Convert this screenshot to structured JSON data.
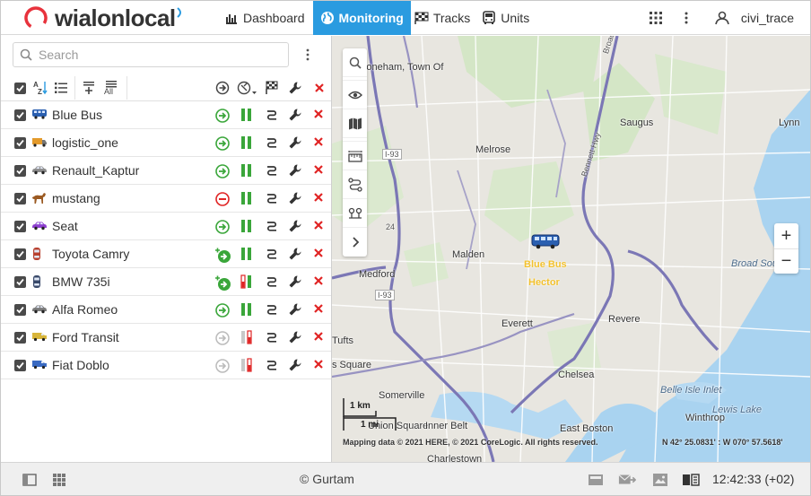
{
  "app": {
    "logo_text": "wialonlocal",
    "user_name": "civi_trace"
  },
  "nav": [
    {
      "label": "Dashboard",
      "icon": "bar-chart-icon"
    },
    {
      "label": "Monitoring",
      "icon": "globe-icon"
    },
    {
      "label": "Tracks",
      "icon": "checkered-flag-icon"
    },
    {
      "label": "Units",
      "icon": "bus-icon"
    }
  ],
  "search": {
    "placeholder": "Search",
    "value": ""
  },
  "toolbar": {
    "sort_label": "AZ",
    "add_all_label": "All"
  },
  "units": [
    {
      "name": "Blue Bus",
      "icon": "bus-icon",
      "color": "#2a5fb0",
      "state": "moving",
      "sensor": "green"
    },
    {
      "name": "logistic_one",
      "icon": "truck-icon",
      "color": "#e39a2b",
      "state": "moving",
      "sensor": "green"
    },
    {
      "name": "Renault_Kaptur",
      "icon": "car-icon",
      "color": "#8a8a8a",
      "state": "moving",
      "sensor": "green"
    },
    {
      "name": "mustang",
      "icon": "horse-icon",
      "color": "#9b5a22",
      "state": "stopped",
      "sensor": "green"
    },
    {
      "name": "Seat",
      "icon": "car-icon",
      "color": "#8e3fd0",
      "state": "moving",
      "sensor": "green"
    },
    {
      "name": "Toyota Camry",
      "icon": "car-top-icon",
      "color": "#b8412f",
      "state": "moving-plus",
      "sensor": "green"
    },
    {
      "name": "BMW 735i",
      "icon": "car-top-icon",
      "color": "#3a4a6a",
      "state": "moving-plus",
      "sensor": "red-green"
    },
    {
      "name": "Alfa Romeo",
      "icon": "car-icon",
      "color": "#7a7a7a",
      "state": "moving",
      "sensor": "green"
    },
    {
      "name": "Ford Transit",
      "icon": "van-icon",
      "color": "#d8b53a",
      "state": "offline",
      "sensor": "gray-red"
    },
    {
      "name": "Fiat Doblo",
      "icon": "van-icon",
      "color": "#3a6ac2",
      "state": "offline",
      "sensor": "gray-red"
    }
  ],
  "map": {
    "labels": [
      {
        "text": "Stoneham, Town Of",
        "kind": "place"
      },
      {
        "text": "Melrose",
        "kind": "place"
      },
      {
        "text": "Saugus",
        "kind": "place"
      },
      {
        "text": "Lynn",
        "kind": "place"
      },
      {
        "text": "Malden",
        "kind": "place"
      },
      {
        "text": "Medford",
        "kind": "place"
      },
      {
        "text": "Everett",
        "kind": "place"
      },
      {
        "text": "Revere",
        "kind": "place"
      },
      {
        "text": "Tufts",
        "kind": "place"
      },
      {
        "text": "Somerville",
        "kind": "place"
      },
      {
        "text": "s Square",
        "kind": "place"
      },
      {
        "text": "Union Square",
        "kind": "place"
      },
      {
        "text": "Inner Belt",
        "kind": "place"
      },
      {
        "text": "Chelsea",
        "kind": "place"
      },
      {
        "text": "East Boston",
        "kind": "place"
      },
      {
        "text": "Winthrop",
        "kind": "place"
      },
      {
        "text": "Charlestown",
        "kind": "place"
      },
      {
        "text": "Broad Sou",
        "kind": "water"
      },
      {
        "text": "Belle Isle Inlet",
        "kind": "water"
      },
      {
        "text": "Lewis Lake",
        "kind": "water"
      },
      {
        "text": "I-93",
        "kind": "road"
      },
      {
        "text": "I-93",
        "kind": "road"
      },
      {
        "text": "Broadway",
        "kind": "road"
      },
      {
        "text": "Bennett Hwy",
        "kind": "road"
      },
      {
        "text": "24",
        "kind": "road"
      }
    ],
    "unit_marker_labels": [
      "Blue Bus",
      "Hector"
    ],
    "scale_labels": [
      "1 km",
      "1 mi"
    ],
    "attribution": "Mapping data © 2021 HERE, © 2021 CoreLogic. All rights reserved.",
    "coordinates": "N 42° 25.0831' : W 070° 57.5618'",
    "zoom_in": "+",
    "zoom_out": "−"
  },
  "footer": {
    "copyright": "© Gurtam",
    "time": "12:42:33 (+02)"
  },
  "colors": {
    "accent": "#2a9be0",
    "green": "#3aa63a",
    "red": "#e02424"
  }
}
